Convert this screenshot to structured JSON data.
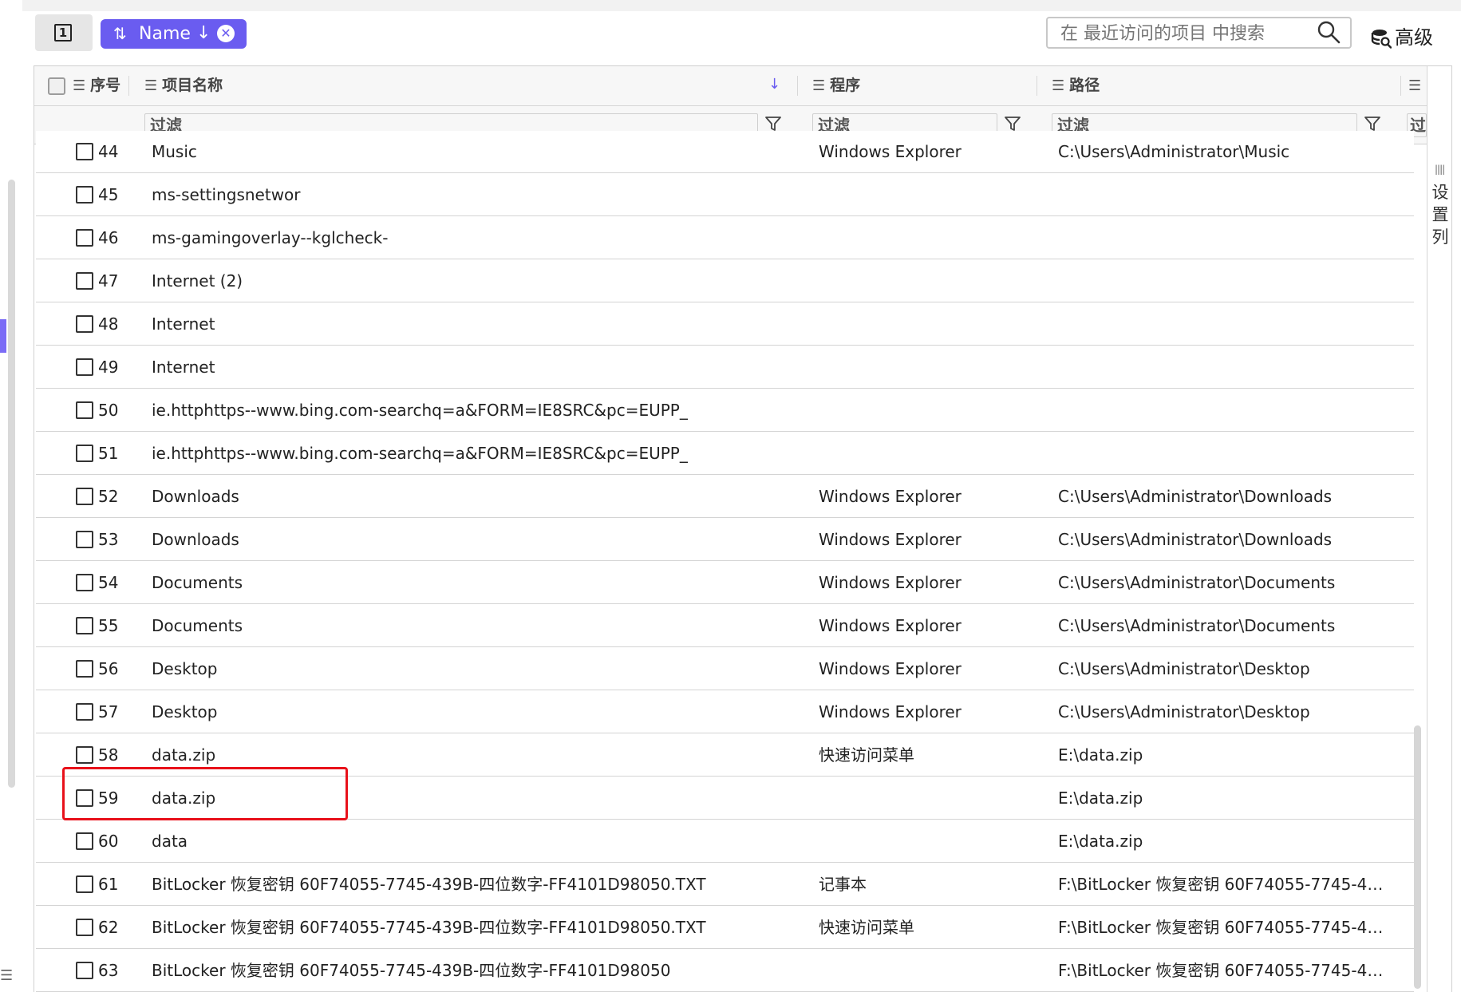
{
  "toolbar": {
    "view_icon_text": "1",
    "sort_chip_label": "Name",
    "sort_chip_direction": "↓",
    "search_placeholder": "在 最近访问的项目 中搜索",
    "advanced_label": "高级",
    "accent_color": "#6a5cf0"
  },
  "grid": {
    "columns": {
      "index": "序号",
      "name": "项目名称",
      "program": "程序",
      "path": "路径"
    },
    "filter_placeholder": "过滤",
    "filter_truncated": "过",
    "column_settings_label": "设置列",
    "rows": [
      {
        "index": "44",
        "name": "Music",
        "program": "Windows Explorer",
        "path": "C:\\Users\\Administrator\\Music"
      },
      {
        "index": "45",
        "name": "ms-settingsnetwor",
        "program": "",
        "path": ""
      },
      {
        "index": "46",
        "name": "ms-gamingoverlay--kglcheck-",
        "program": "",
        "path": ""
      },
      {
        "index": "47",
        "name": "Internet (2)",
        "program": "",
        "path": ""
      },
      {
        "index": "48",
        "name": "Internet",
        "program": "",
        "path": ""
      },
      {
        "index": "49",
        "name": "Internet",
        "program": "",
        "path": ""
      },
      {
        "index": "50",
        "name": "ie.httphttps--www.bing.com-searchq=a&FORM=IE8SRC&pc=EUPP_",
        "program": "",
        "path": ""
      },
      {
        "index": "51",
        "name": "ie.httphttps--www.bing.com-searchq=a&FORM=IE8SRC&pc=EUPP_",
        "program": "",
        "path": ""
      },
      {
        "index": "52",
        "name": "Downloads",
        "program": "Windows Explorer",
        "path": "C:\\Users\\Administrator\\Downloads"
      },
      {
        "index": "53",
        "name": "Downloads",
        "program": "Windows Explorer",
        "path": "C:\\Users\\Administrator\\Downloads"
      },
      {
        "index": "54",
        "name": "Documents",
        "program": "Windows Explorer",
        "path": "C:\\Users\\Administrator\\Documents"
      },
      {
        "index": "55",
        "name": "Documents",
        "program": "Windows Explorer",
        "path": "C:\\Users\\Administrator\\Documents"
      },
      {
        "index": "56",
        "name": "Desktop",
        "program": "Windows Explorer",
        "path": "C:\\Users\\Administrator\\Desktop"
      },
      {
        "index": "57",
        "name": "Desktop",
        "program": "Windows Explorer",
        "path": "C:\\Users\\Administrator\\Desktop"
      },
      {
        "index": "58",
        "name": "data.zip",
        "program": "快速访问菜单",
        "path": "E:\\data.zip"
      },
      {
        "index": "59",
        "name": "data.zip",
        "program": "",
        "path": "E:\\data.zip"
      },
      {
        "index": "60",
        "name": "data",
        "program": "",
        "path": "E:\\data.zip"
      },
      {
        "index": "61",
        "name": "BitLocker 恢复密钥 60F74055-7745-439B-四位数字-FF4101D98050.TXT",
        "program": "记事本",
        "path": "F:\\BitLocker 恢复密钥 60F74055-7745-439..."
      },
      {
        "index": "62",
        "name": "BitLocker 恢复密钥 60F74055-7745-439B-四位数字-FF4101D98050.TXT",
        "program": "快速访问菜单",
        "path": "F:\\BitLocker 恢复密钥 60F74055-7745-439..."
      },
      {
        "index": "63",
        "name": "BitLocker 恢复密钥 60F74055-7745-439B-四位数字-FF4101D98050",
        "program": "",
        "path": "F:\\BitLocker 恢复密钥 60F74055-7745-439..."
      }
    ],
    "highlighted_row_index": "59",
    "highlight_color": "#e8111a"
  }
}
